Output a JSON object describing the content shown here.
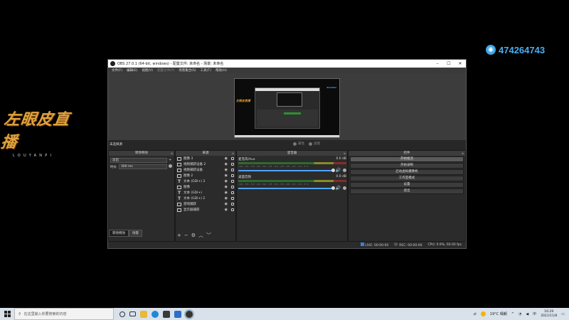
{
  "logo": {
    "main": "左眼皮直播",
    "sub": "LOUYANPI"
  },
  "badge": {
    "icon": "qq-icon",
    "number": "474264743"
  },
  "obs": {
    "title": "OBS 27.0.1 (64-bit, windows) - 配置文件: 未命名 - 场景: 未命名",
    "window_buttons": [
      "–",
      "☐",
      "✕"
    ],
    "menu": [
      {
        "label": "文件(F)",
        "enabled": true
      },
      {
        "label": "编辑(E)",
        "enabled": true
      },
      {
        "label": "视图(V)",
        "enabled": true
      },
      {
        "label": "配置文件(P)",
        "enabled": false
      },
      {
        "label": "场景集合(S)",
        "enabled": true
      },
      {
        "label": "工具(T)",
        "enabled": true
      },
      {
        "label": "帮助(H)",
        "enabled": true
      }
    ],
    "preview": {
      "brand": "Sinoline",
      "left_logo": "左眼皮直播"
    },
    "scene_label": "未选择源",
    "row_buttons": [
      "属性",
      "滤镜"
    ],
    "transitions": {
      "header": "转场特效",
      "selected": "淡出",
      "duration_label": "时长",
      "duration": "300 ms",
      "tabs": [
        "转场特效",
        "场景"
      ]
    },
    "sources": {
      "header": "来源",
      "items": [
        {
          "icon": "box",
          "label": "图像 3"
        },
        {
          "icon": "box",
          "label": "视频捕获设备 2"
        },
        {
          "icon": "box",
          "label": "视频捕获设备"
        },
        {
          "icon": "box",
          "label": "图像 2"
        },
        {
          "icon": "text",
          "label": "文本 (GDI+) 3"
        },
        {
          "icon": "box",
          "label": "图像"
        },
        {
          "icon": "text",
          "label": "文本 (GDI+)"
        },
        {
          "icon": "text",
          "label": "文本 (GDI+) 2"
        },
        {
          "icon": "box",
          "label": "游戏捕获"
        },
        {
          "icon": "box",
          "label": "显示器捕获"
        }
      ],
      "footer": [
        "+",
        "−",
        "⚙",
        "︿",
        "﹀"
      ]
    },
    "mixer": {
      "header": "混音器",
      "ticks": "-60 -55 -50 -45 -40 -35 -30 -25 -20 -15 -10 -5 0",
      "channels": [
        {
          "name": "麦克风/Aux",
          "db": "0.0 dB"
        },
        {
          "name": "桌面音频",
          "db": "0.0 dB"
        }
      ]
    },
    "controls": {
      "header": "控件",
      "buttons": [
        "开始推流",
        "开始录制",
        "启动虚拟摄像机",
        "工作室模式",
        "设置",
        "退出"
      ]
    },
    "status": {
      "live": "LIVE: 00:00:00",
      "rec": "REC: 00:00:00",
      "cpu": "CPU: 0.9%, 60.00 fps"
    }
  },
  "taskbar": {
    "search_placeholder": "在这里输入你要搜索的内容",
    "weather": "19°C 晴朗",
    "time": "16:29",
    "date": "2021/11/8"
  }
}
